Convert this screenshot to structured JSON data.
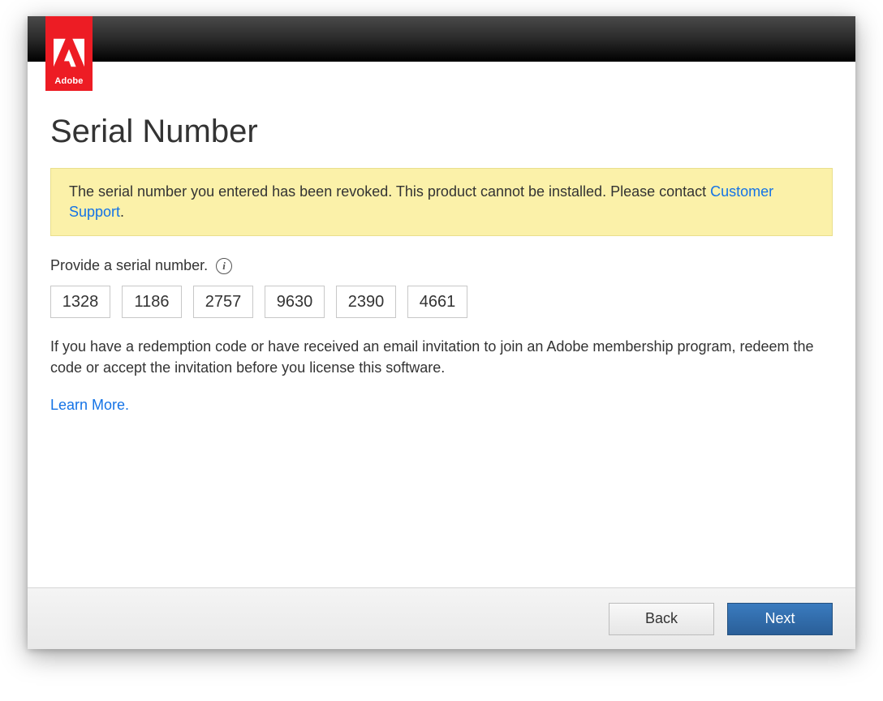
{
  "brand": {
    "name": "Adobe"
  },
  "page": {
    "title": "Serial Number"
  },
  "warning": {
    "text_before_link": "The serial number you entered has been revoked. This product cannot be installed. Please contact ",
    "link_text": "Customer Support",
    "text_after_link": "."
  },
  "serial": {
    "prompt": "Provide a serial number.",
    "fields": [
      "1328",
      "1186",
      "2757",
      "9630",
      "2390",
      "4661"
    ]
  },
  "redemption_info": "If you have a redemption code or have received an email invitation to join an Adobe membership program, redeem the code or accept the invitation before you license this software.",
  "learn_more": "Learn More.",
  "buttons": {
    "back": "Back",
    "next": "Next"
  }
}
